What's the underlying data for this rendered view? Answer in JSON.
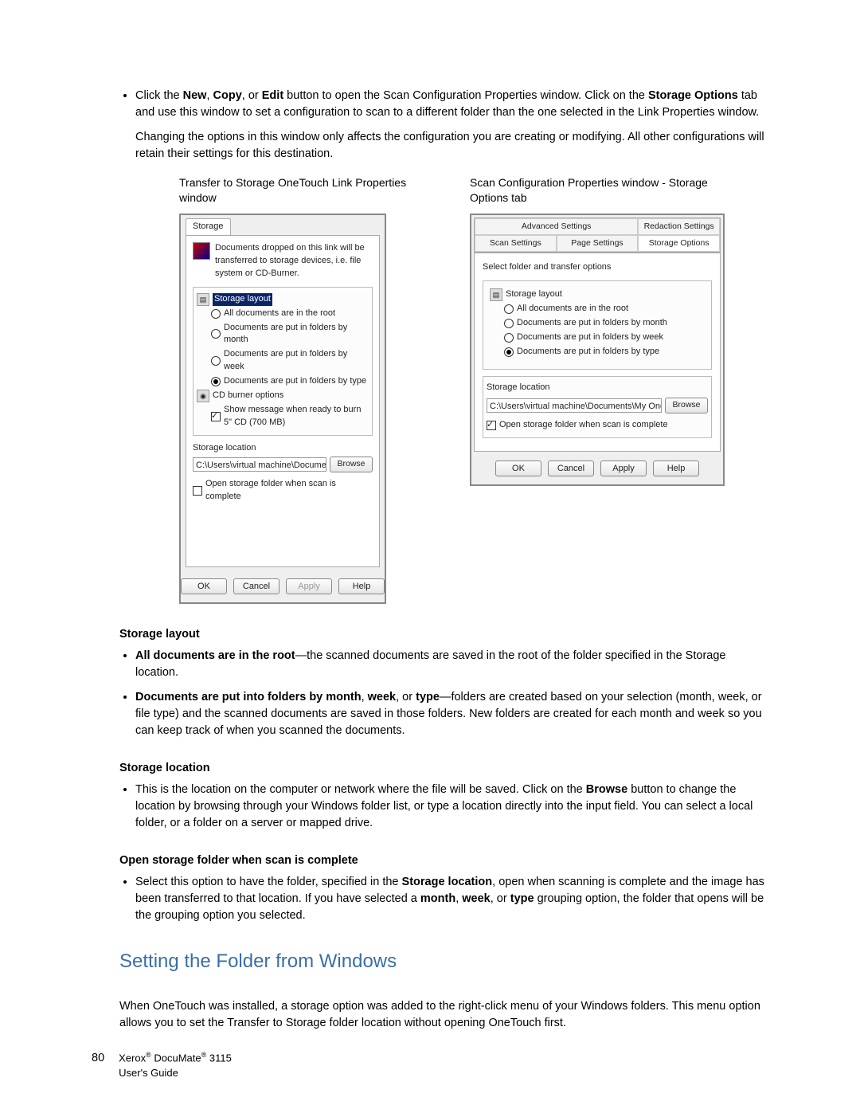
{
  "intro": {
    "bullet1_pre": "Click the ",
    "bullet1_b1": "New",
    "bullet1_mid1": ", ",
    "bullet1_b2": "Copy",
    "bullet1_mid2": ", or ",
    "bullet1_b3": "Edit",
    "bullet1_mid3": " button to open the Scan Configuration Properties window. Click on the ",
    "bullet1_b4": "Storage Options",
    "bullet1_post": " tab and use this window to set a configuration to scan to a different folder than the one selected in the Link Properties window.",
    "note": "Changing the options in this window only affects the configuration you are creating or modifying. All other configurations will retain their settings for this destination."
  },
  "captions": {
    "left": "Transfer to Storage OneTouch Link Properties window",
    "right": "Scan Configuration Properties window - Storage Options tab"
  },
  "dialog1": {
    "tab": "Storage",
    "desc": "Documents dropped on this link will be transferred to storage devices, i.e. file system or CD-Burner.",
    "layout_title": "Storage layout",
    "opts": {
      "root": "All documents are in the root",
      "month": "Documents are put in folders by month",
      "week": "Documents are put in folders by week",
      "type": "Documents are put in folders by type"
    },
    "cd_title": "CD burner options",
    "cd_opt": "Show message when ready to burn 5\" CD (700 MB)",
    "loc_label": "Storage location",
    "path": "C:\\Users\\virtual machine\\Documents\\My OneTou",
    "browse": "Browse",
    "open_chk": "Open storage folder when scan is complete",
    "btns": {
      "ok": "OK",
      "cancel": "Cancel",
      "apply": "Apply",
      "help": "Help"
    }
  },
  "dialog2": {
    "tabs_top": {
      "adv": "Advanced Settings",
      "red": "Redaction Settings"
    },
    "tabs_bot": {
      "scan": "Scan Settings",
      "page": "Page Settings",
      "store": "Storage Options"
    },
    "sel_label": "Select folder and transfer options",
    "layout_title": "Storage layout",
    "opts": {
      "root": "All documents are in the root",
      "month": "Documents are put in folders by month",
      "week": "Documents are put in folders by week",
      "type": "Documents are put in folders by type"
    },
    "loc_label": "Storage location",
    "path": "C:\\Users\\virtual machine\\Documents\\My OneTouch",
    "browse": "Browse",
    "open_chk": "Open storage folder when scan is complete",
    "btns": {
      "ok": "OK",
      "cancel": "Cancel",
      "apply": "Apply",
      "help": "Help"
    }
  },
  "sections": {
    "layout_h": "Storage layout",
    "layout_b1_b": "All documents are in the root",
    "layout_b1_t": "—the scanned documents are saved in the root of the folder specified in the Storage location.",
    "layout_b2_b": "Documents are put into folders by month",
    "layout_b2_mid1": ", ",
    "layout_b2_b2": "week",
    "layout_b2_mid2": ", or ",
    "layout_b2_b3": "type",
    "layout_b2_t": "—folders are created based on your selection (month, week, or file type) and the scanned documents are saved in those folders. New folders are created for each month and week so you can keep track of when you scanned the documents.",
    "loc_h": "Storage location",
    "loc_b_pre": "This is the location on the computer or network where the file will be saved. Click on the ",
    "loc_b_bold": "Browse",
    "loc_b_post": " button to change the location by browsing through your Windows folder list, or type a location directly into the input field. You can select a local folder, or a folder on a server or mapped drive.",
    "open_h": "Open storage folder when scan is complete",
    "open_b_pre": "Select this option to have the folder, specified in the ",
    "open_b_b1": "Storage location",
    "open_b_mid1": ", open when scanning is complete and the image has been transferred to that location. If you have selected a ",
    "open_b_b2": "month",
    "open_b_mid2": ", ",
    "open_b_b3": "week",
    "open_b_mid3": ", or ",
    "open_b_b4": "type",
    "open_b_post": " grouping option, the folder that opens will be the grouping option you selected."
  },
  "h2": "Setting the Folder from Windows",
  "para_after_h2": "When OneTouch was installed, a storage option was added to the right-click menu of your Windows folders. This menu option allows you to set the Transfer to Storage folder location without opening OneTouch first.",
  "footer": {
    "page": "80",
    "line1a": "Xerox",
    "line1b": " DocuMate",
    "line1c": " 3115",
    "line2": "User's Guide"
  }
}
